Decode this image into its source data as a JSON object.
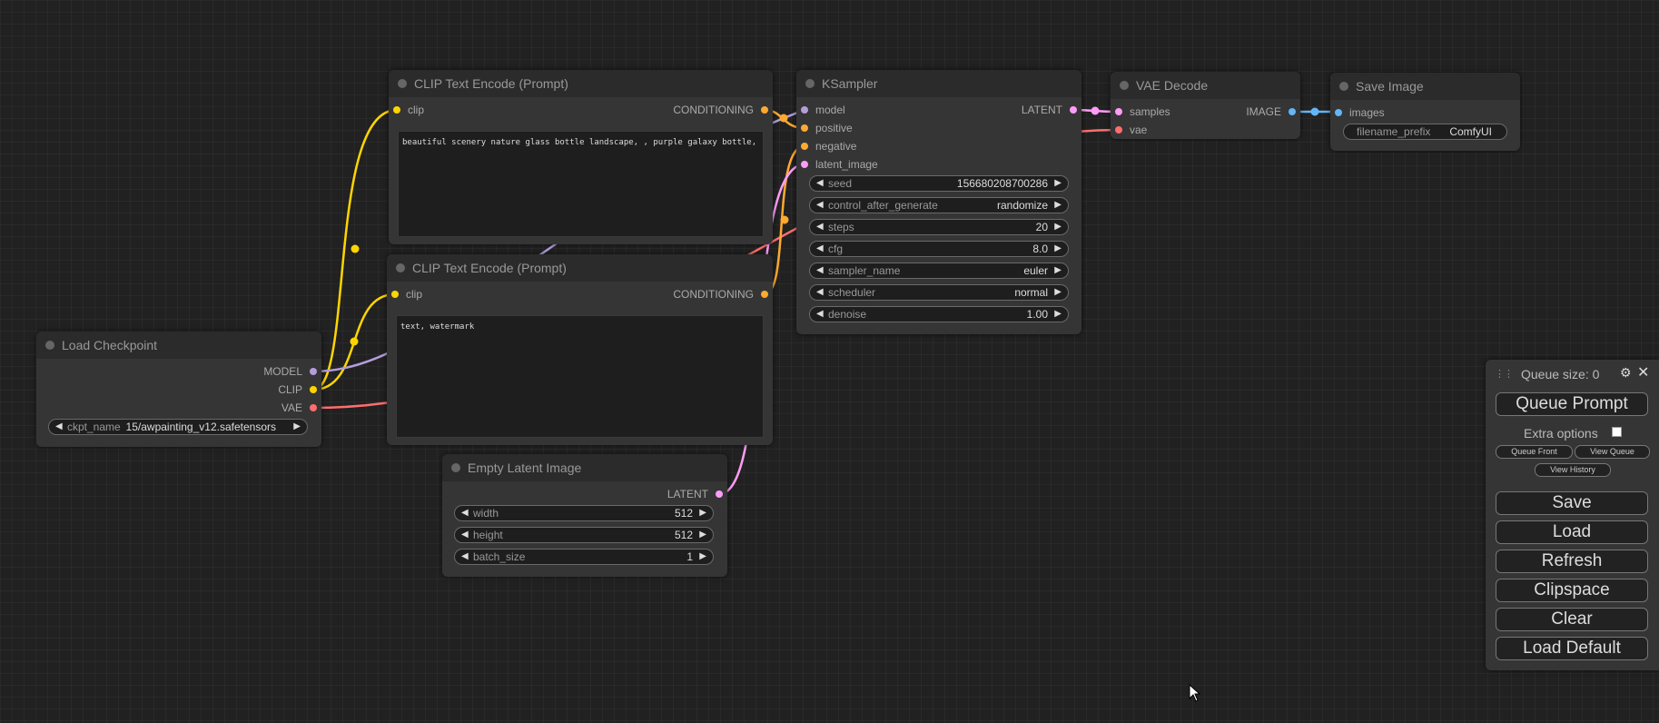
{
  "nodes": {
    "clip_pos": {
      "title": "CLIP Text Encode (Prompt)",
      "input": "clip",
      "output": "CONDITIONING",
      "text": "beautiful scenery nature glass bottle landscape, , purple galaxy bottle,"
    },
    "clip_neg": {
      "title": "CLIP Text Encode (Prompt)",
      "input": "clip",
      "output": "CONDITIONING",
      "text": "text, watermark"
    },
    "ksampler": {
      "title": "KSampler",
      "inputs": [
        "model",
        "positive",
        "negative",
        "latent_image"
      ],
      "output": "LATENT",
      "widgets": [
        {
          "label": "seed",
          "value": "156680208700286"
        },
        {
          "label": "control_after_generate",
          "value": "randomize"
        },
        {
          "label": "steps",
          "value": "20"
        },
        {
          "label": "cfg",
          "value": "8.0"
        },
        {
          "label": "sampler_name",
          "value": "euler"
        },
        {
          "label": "scheduler",
          "value": "normal"
        },
        {
          "label": "denoise",
          "value": "1.00"
        }
      ]
    },
    "vae_decode": {
      "title": "VAE Decode",
      "inputs": [
        "samples",
        "vae"
      ],
      "output": "IMAGE"
    },
    "save_image": {
      "title": "Save Image",
      "input": "images",
      "widget": {
        "label": "filename_prefix",
        "value": "ComfyUI"
      }
    },
    "load_checkpoint": {
      "title": "Load Checkpoint",
      "outputs": [
        "MODEL",
        "CLIP",
        "VAE"
      ],
      "widget": {
        "label": "ckpt_name",
        "value": "15/awpainting_v12.safetensors"
      }
    },
    "empty_latent": {
      "title": "Empty Latent Image",
      "output": "LATENT",
      "widgets": [
        {
          "label": "width",
          "value": "512"
        },
        {
          "label": "height",
          "value": "512"
        },
        {
          "label": "batch_size",
          "value": "1"
        }
      ]
    }
  },
  "menu": {
    "queue_size": "Queue size: 0",
    "queue_prompt": "Queue Prompt",
    "extra_options": "Extra options",
    "queue_front": "Queue Front",
    "view_queue": "View Queue",
    "view_history": "View History",
    "save": "Save",
    "load": "Load",
    "refresh": "Refresh",
    "clipspace": "Clipspace",
    "clear": "Clear",
    "load_default": "Load Default"
  },
  "colors": {
    "clip": "#ffd500",
    "model": "#b39ddb",
    "vae": "#ff6e6e",
    "conditioning": "#ffa931",
    "latent": "#ff9cf9",
    "image": "#64b5f6"
  }
}
